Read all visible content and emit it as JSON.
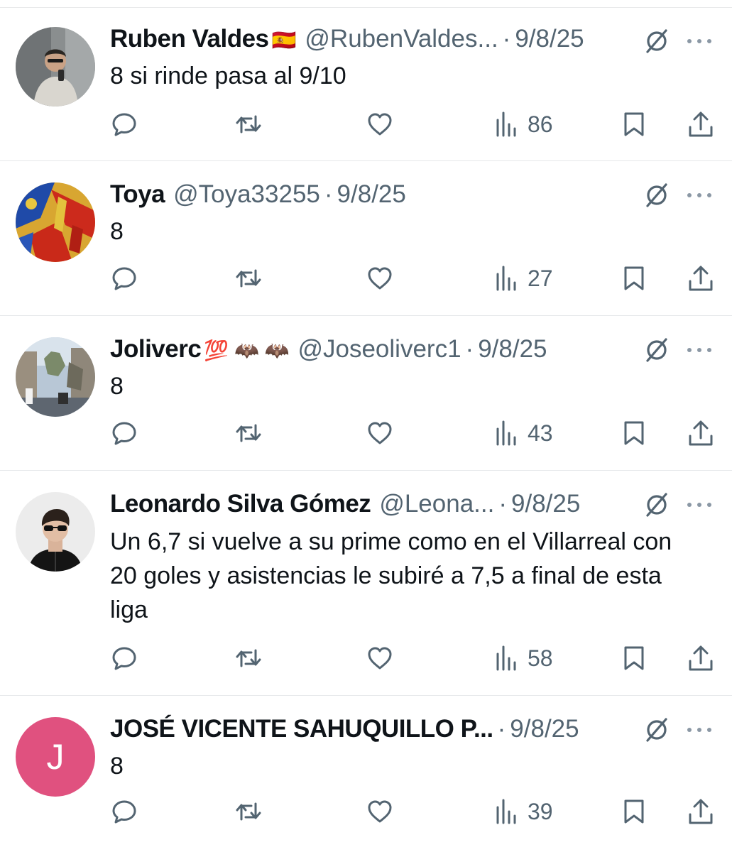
{
  "colors": {
    "text": "#0f1419",
    "secondary": "#536471",
    "divider": "#e6e8ea",
    "avatar_letter_bg": "#e0517f"
  },
  "icons": {
    "reply": "reply-icon",
    "repost": "repost-icon",
    "like": "heart-icon",
    "views": "views-bar-chart-icon",
    "bookmark": "bookmark-icon",
    "share": "share-icon",
    "grok": "grok-slash-circle-icon",
    "more": "more-dots-icon"
  },
  "posts": [
    {
      "name": "Ruben Valdes",
      "name_emoji": "🇪🇸",
      "handle": "@RubenValdes...",
      "separator": "·",
      "date": "9/8/25",
      "text": "8 si rinde pasa al 9/10",
      "views": "86",
      "avatar": "photo"
    },
    {
      "name": "Toya",
      "name_emoji": "",
      "handle": "@Toya33255",
      "separator": "·",
      "date": "9/8/25",
      "text": "8",
      "views": "27",
      "avatar": "flag"
    },
    {
      "name": "Joliverc",
      "name_emoji": "💯 🦇 🦇",
      "handle": "@Joseoliverc1",
      "separator": "·",
      "date": "9/8/25",
      "text": "8",
      "views": "43",
      "avatar": "photo"
    },
    {
      "name": "Leonardo Silva Gómez",
      "name_emoji": "",
      "handle": "@Leona...",
      "separator": "·",
      "date": "9/8/25",
      "text": "Un 6,7 si vuelve a su prime como en el Villarreal con 20 goles y asistencias le subiré a 7,5 a final de esta liga",
      "views": "58",
      "avatar": "photo"
    },
    {
      "name": "JOSÉ VICENTE SAHUQUILLO P...",
      "name_emoji": "",
      "handle": "",
      "separator": "·",
      "date": "9/8/25",
      "text": "8",
      "views": "39",
      "avatar": "letter",
      "avatar_letter": "J"
    }
  ]
}
